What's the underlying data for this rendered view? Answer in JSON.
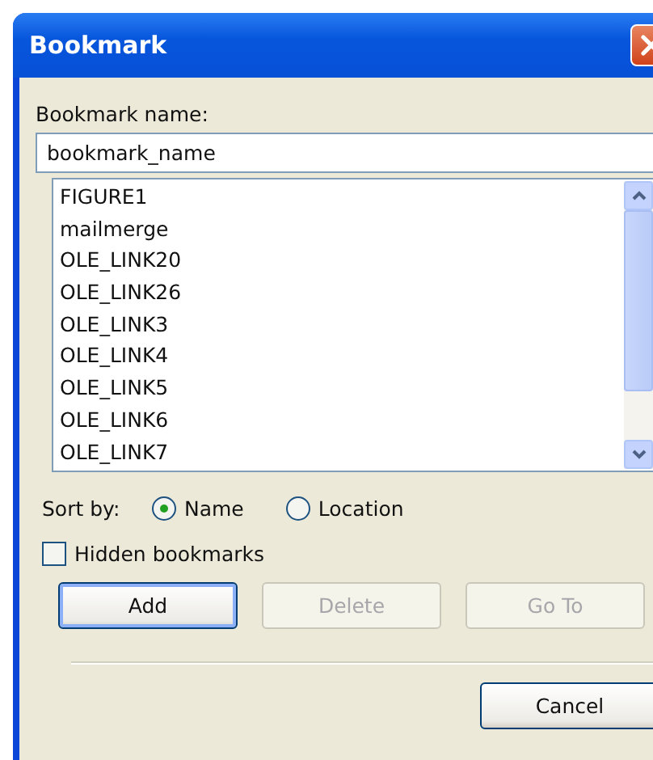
{
  "window": {
    "title": "Bookmark"
  },
  "name_field": {
    "label": "Bookmark name:",
    "value": "bookmark_name"
  },
  "bookmarks": [
    {
      "label": "FIGURE1"
    },
    {
      "label": "mailmerge"
    },
    {
      "label": "OLE_LINK20"
    },
    {
      "label": "OLE_LINK26"
    },
    {
      "label": "OLE_LINK3"
    },
    {
      "label": "OLE_LINK4"
    },
    {
      "label": "OLE_LINK5"
    },
    {
      "label": "OLE_LINK6"
    },
    {
      "label": "OLE_LINK7"
    }
  ],
  "sort_by": {
    "label": "Sort by:",
    "options": [
      {
        "label": "Name",
        "selected": true
      },
      {
        "label": "Location",
        "selected": false
      }
    ]
  },
  "hidden_bookmarks": {
    "label": "Hidden bookmarks",
    "checked": false
  },
  "buttons": [
    {
      "label": "Add",
      "disabled": false,
      "default": true
    },
    {
      "label": "Delete",
      "disabled": true,
      "default": false
    },
    {
      "label": "Go To",
      "disabled": true,
      "default": false
    }
  ],
  "footer_buttons": [
    {
      "label": "Cancel",
      "disabled": false,
      "default": false
    }
  ]
}
